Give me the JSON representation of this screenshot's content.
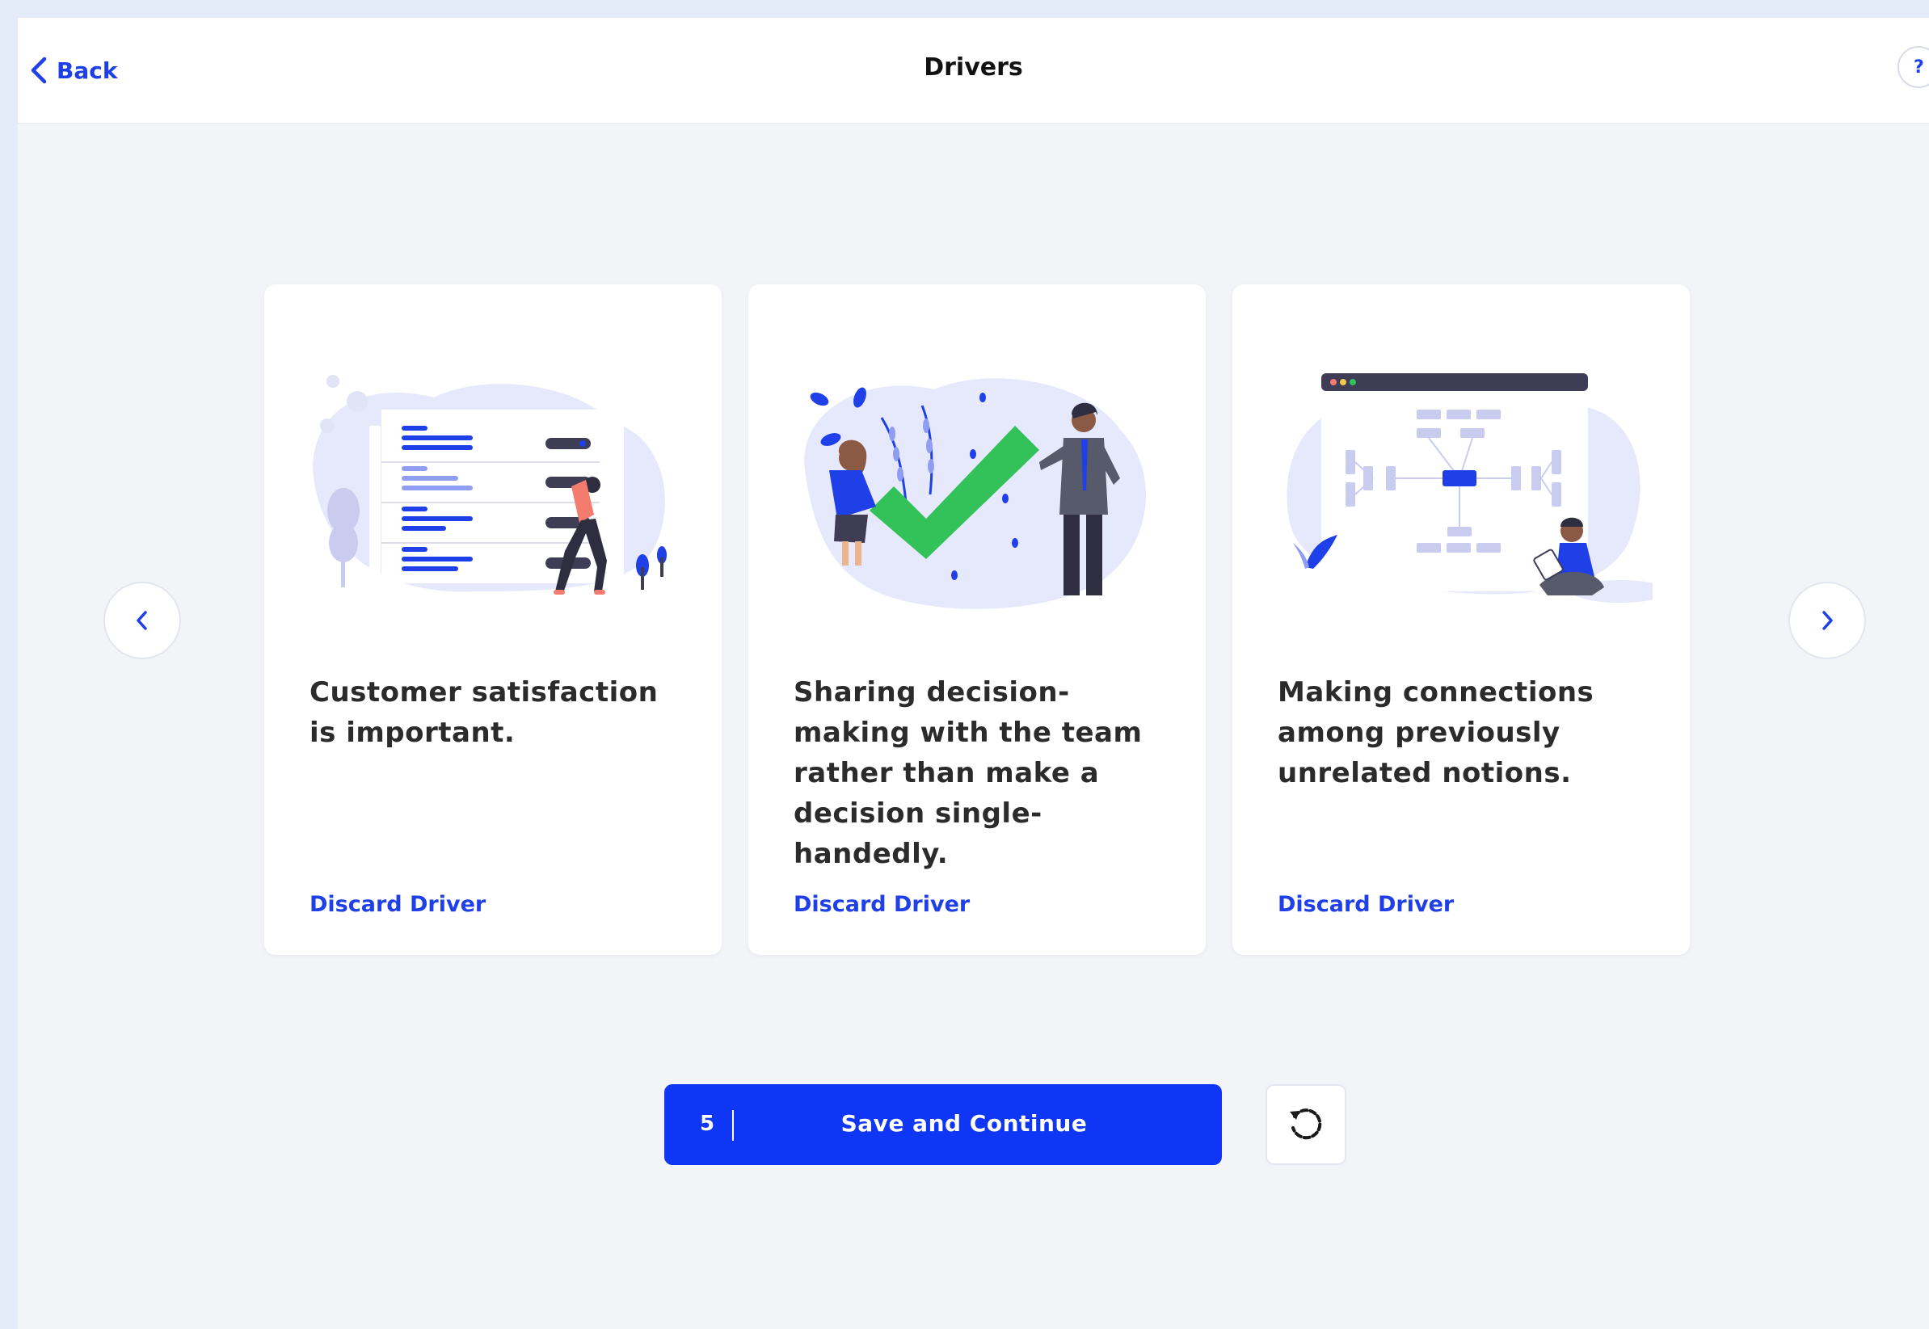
{
  "header": {
    "back_label": "Back",
    "title": "Drivers",
    "help_label": "?"
  },
  "cards": [
    {
      "text": "Customer satisfaction is important.",
      "discard_label": "Discard Driver"
    },
    {
      "text": "Sharing decision-making with the team rather than make a decision single-handedly.",
      "discard_label": "Discard Driver"
    },
    {
      "text": "Making connections among previously unrelated notions.",
      "discard_label": "Discard Driver"
    }
  ],
  "footer": {
    "count": "5",
    "save_label": "Save and Continue"
  },
  "icons": {
    "back": "chevron-left-icon",
    "prev": "chevron-left-icon",
    "next": "chevron-right-icon",
    "reset": "reset-icon",
    "help": "help-icon"
  },
  "colors": {
    "accent": "#0f36f5",
    "link": "#1f3fe8",
    "background": "#f3f4f8",
    "card": "#ffffff",
    "check_green": "#33c15a"
  }
}
